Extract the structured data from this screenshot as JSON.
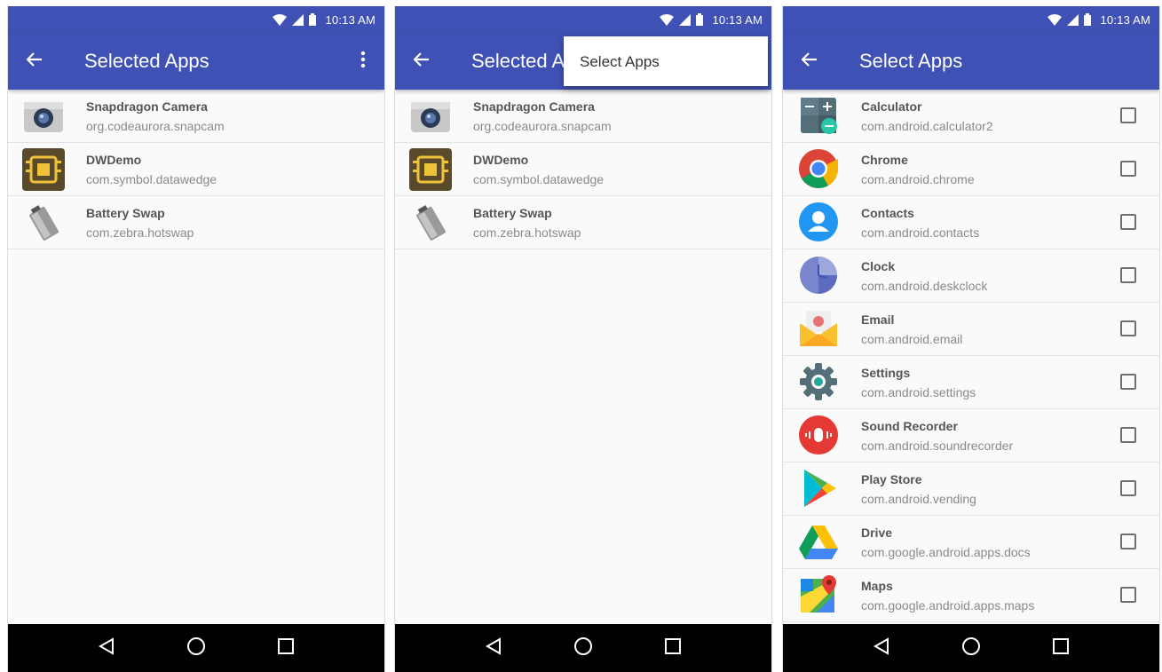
{
  "status": {
    "time": "10:13 AM"
  },
  "screen1": {
    "title": "Selected Apps",
    "apps": [
      {
        "name": "Snapdragon Camera",
        "package": "org.codeaurora.snapcam",
        "icon": "camera-icon"
      },
      {
        "name": "DWDemo",
        "package": "com.symbol.datawedge",
        "icon": "dwdemo-icon"
      },
      {
        "name": "Battery Swap",
        "package": "com.zebra.hotswap",
        "icon": "battery-icon"
      }
    ]
  },
  "screen2": {
    "title": "Selected Apps",
    "menu": {
      "items": [
        "Select Apps"
      ]
    },
    "apps": [
      {
        "name": "Snapdragon Camera",
        "package": "org.codeaurora.snapcam",
        "icon": "camera-icon"
      },
      {
        "name": "DWDemo",
        "package": "com.symbol.datawedge",
        "icon": "dwdemo-icon"
      },
      {
        "name": "Battery Swap",
        "package": "com.zebra.hotswap",
        "icon": "battery-icon"
      }
    ]
  },
  "screen3": {
    "title": "Select Apps",
    "apps": [
      {
        "name": "Calculator",
        "package": "com.android.calculator2",
        "icon": "calculator-icon",
        "checked": false
      },
      {
        "name": "Chrome",
        "package": "com.android.chrome",
        "icon": "chrome-icon",
        "checked": false
      },
      {
        "name": "Contacts",
        "package": "com.android.contacts",
        "icon": "contacts-icon",
        "checked": false
      },
      {
        "name": "Clock",
        "package": "com.android.deskclock",
        "icon": "clock-icon",
        "checked": false
      },
      {
        "name": "Email",
        "package": "com.android.email",
        "icon": "email-icon",
        "checked": false
      },
      {
        "name": "Settings",
        "package": "com.android.settings",
        "icon": "settings-icon",
        "checked": false
      },
      {
        "name": "Sound Recorder",
        "package": "com.android.soundrecorder",
        "icon": "sound-recorder-icon",
        "checked": false
      },
      {
        "name": "Play Store",
        "package": "com.android.vending",
        "icon": "play-store-icon",
        "checked": false
      },
      {
        "name": "Drive",
        "package": "com.google.android.apps.docs",
        "icon": "drive-icon",
        "checked": false
      },
      {
        "name": "Maps",
        "package": "com.google.android.apps.maps",
        "icon": "maps-icon",
        "checked": false
      }
    ]
  },
  "colors": {
    "primary": "#3f51b5",
    "navbar": "#000000",
    "background": "#fafafa"
  }
}
